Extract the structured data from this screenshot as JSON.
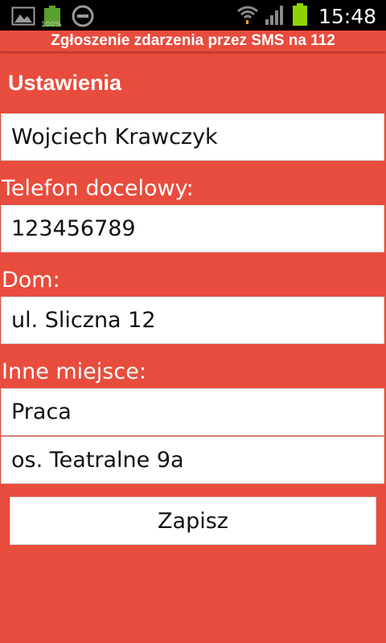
{
  "status_bar": {
    "time": "15:48",
    "battery_percent_label": "100%",
    "icons": [
      "gallery-icon",
      "battery-icon",
      "do-not-disturb-icon",
      "wifi-icon",
      "signal-icon",
      "battery-icon"
    ]
  },
  "app": {
    "title": "Zgłoszenie zdarzenia przez SMS na 112",
    "accent_color": "#e84c3d"
  },
  "settings": {
    "heading": "Ustawienia",
    "name_value": "Wojciech Krawczyk",
    "phone_label": "Telefon docelowy:",
    "phone_value": "123456789",
    "home_label": "Dom:",
    "home_value": "ul. Sliczna 12",
    "other_label": "Inne miejsce:",
    "other_name_value": "Praca",
    "other_address_value": "os. Teatralne 9a",
    "save_label": "Zapisz"
  }
}
